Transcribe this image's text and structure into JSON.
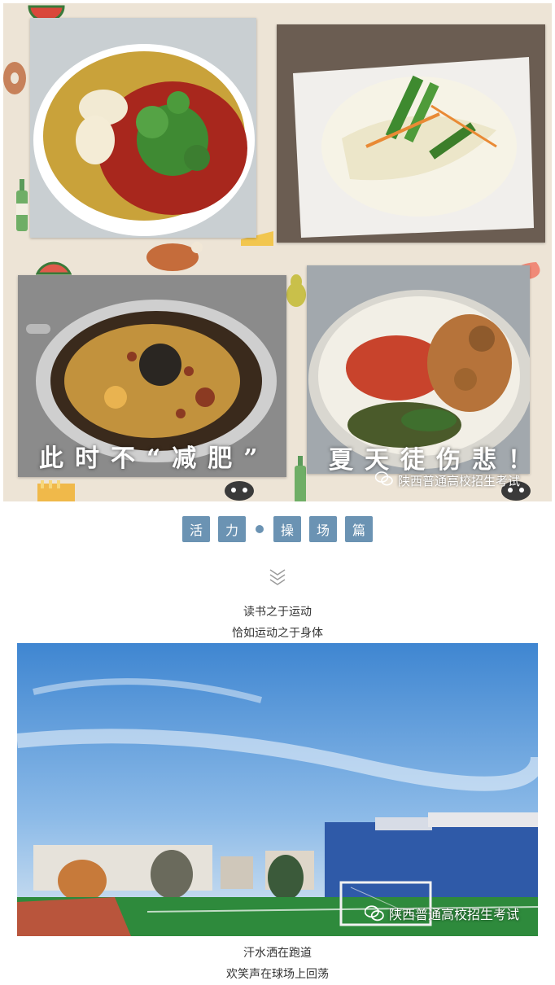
{
  "collage": {
    "caption_left": "此时不“减肥”",
    "caption_right": "夏天徒伤悲！",
    "watermark": "陕西普通高校招生考试"
  },
  "tabs": [
    "活",
    "力",
    "操",
    "场",
    "篇"
  ],
  "intro": {
    "line1": "读书之于运动",
    "line2": "恰如运动之于身体"
  },
  "field_photo": {
    "watermark": "陕西普通高校招生考试"
  },
  "outro": {
    "line1": "汗水洒在跑道",
    "line2": "欢笑声在球场上回荡"
  },
  "colors": {
    "accent": "#6b93b3",
    "pattern_bg": "#ede4d6",
    "sky": "#4a8fd6",
    "turf": "#2e8a3c",
    "track": "#b9553c"
  }
}
